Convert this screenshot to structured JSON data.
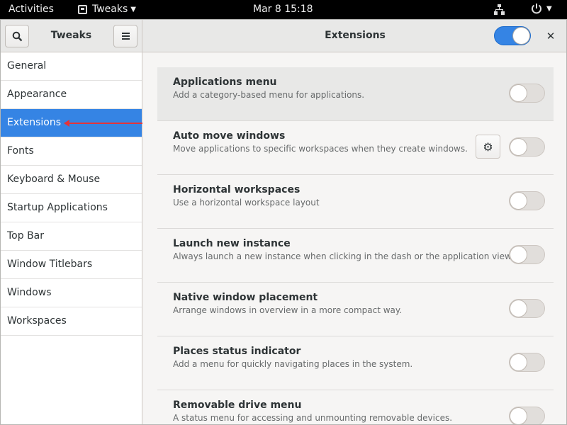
{
  "topbar": {
    "activities": "Activities",
    "app_name": "Tweaks",
    "clock": "Mar 8  15:18"
  },
  "header": {
    "left_title": "Tweaks",
    "main_title": "Extensions",
    "extensions_enabled": true
  },
  "sidebar": {
    "items": [
      {
        "label": "General",
        "selected": false
      },
      {
        "label": "Appearance",
        "selected": false
      },
      {
        "label": "Extensions",
        "selected": true
      },
      {
        "label": "Fonts",
        "selected": false
      },
      {
        "label": "Keyboard & Mouse",
        "selected": false
      },
      {
        "label": "Startup Applications",
        "selected": false
      },
      {
        "label": "Top Bar",
        "selected": false
      },
      {
        "label": "Window Titlebars",
        "selected": false
      },
      {
        "label": "Windows",
        "selected": false
      },
      {
        "label": "Workspaces",
        "selected": false
      }
    ]
  },
  "extensions": [
    {
      "name": "Applications menu",
      "description": "Add a category-based menu for applications.",
      "enabled": false,
      "has_settings": false
    },
    {
      "name": "Auto move windows",
      "description": "Move applications to specific workspaces when they create windows.",
      "enabled": false,
      "has_settings": true
    },
    {
      "name": "Horizontal workspaces",
      "description": "Use a horizontal workspace layout",
      "enabled": false,
      "has_settings": false
    },
    {
      "name": "Launch new instance",
      "description": "Always launch a new instance when clicking in the dash or the application view.",
      "enabled": false,
      "has_settings": false
    },
    {
      "name": "Native window placement",
      "description": "Arrange windows in overview in a more compact way.",
      "enabled": false,
      "has_settings": false
    },
    {
      "name": "Places status indicator",
      "description": "Add a menu for quickly navigating places in the system.",
      "enabled": false,
      "has_settings": false
    },
    {
      "name": "Removable drive menu",
      "description": "A status menu for accessing and unmounting removable devices.",
      "enabled": false,
      "has_settings": false
    }
  ],
  "icons": {
    "search": "search-icon",
    "menu": "hamburger-menu-icon",
    "close": "close-icon",
    "gear": "gear-icon",
    "network": "network-icon",
    "power": "power-icon"
  },
  "colors": {
    "accent": "#3584e4",
    "annotation_arrow": "#e4343a"
  }
}
